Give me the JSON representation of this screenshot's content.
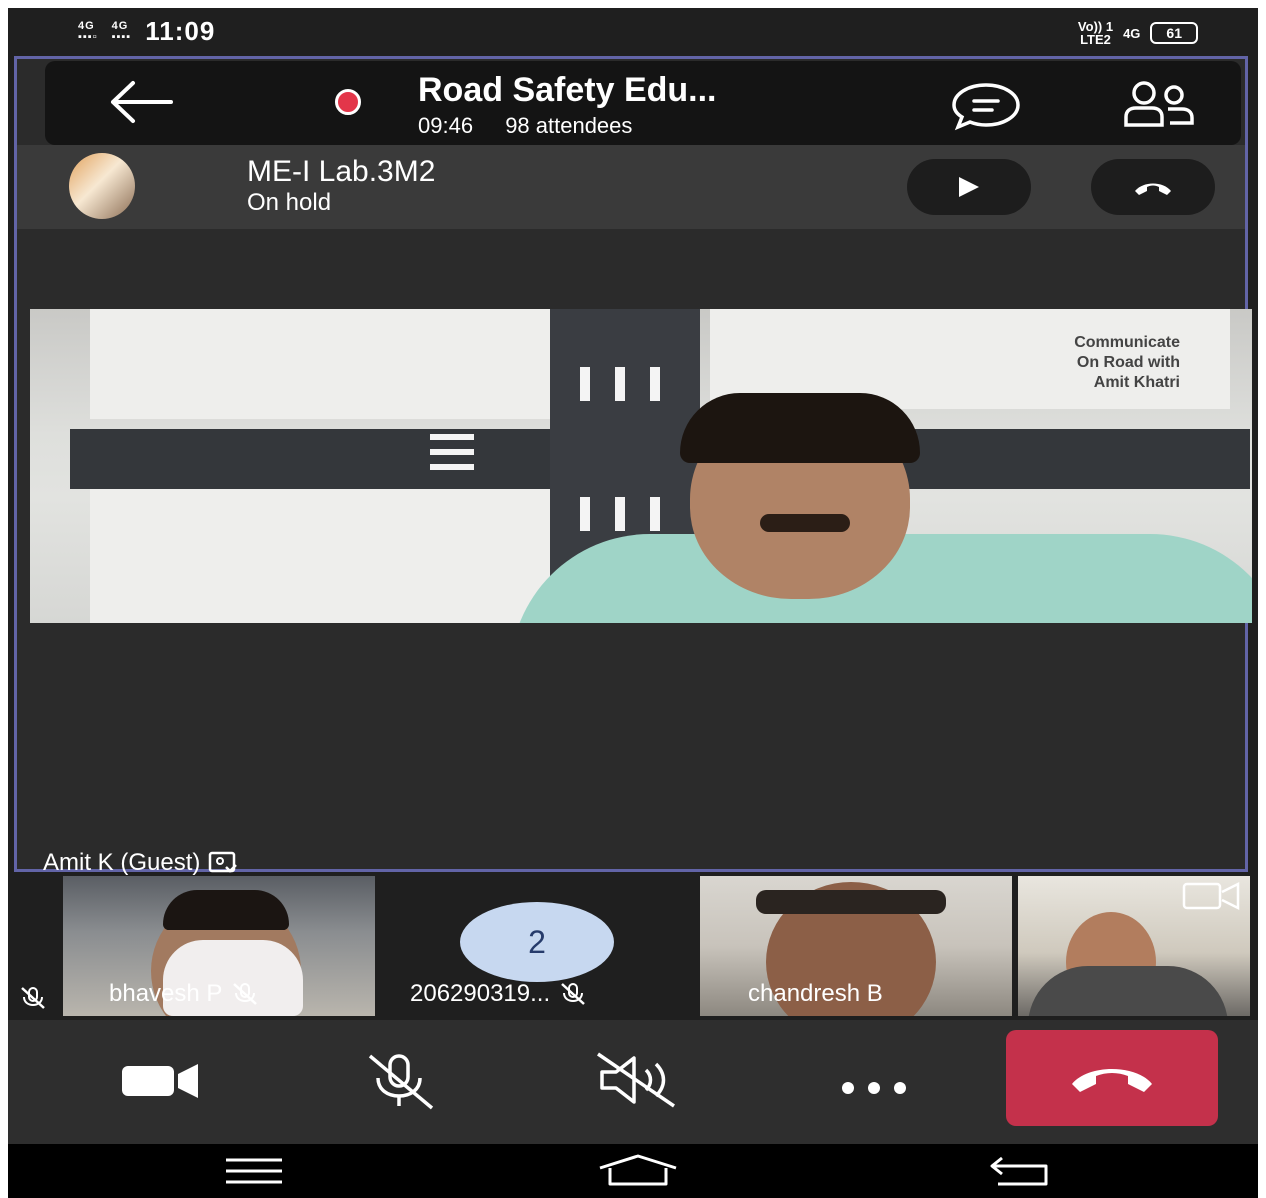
{
  "status_bar": {
    "network_1": "4G",
    "network_2": "4G",
    "time": "11:09",
    "right_text_1": "Vo)) 1",
    "right_text_2": "LTE2",
    "network_3": "4G",
    "battery": "61"
  },
  "meeting": {
    "title": "Road Safety Edu...",
    "duration": "09:46",
    "attendees": "98 attendees"
  },
  "hold_call": {
    "name": "ME-I Lab.3M2",
    "status": "On hold"
  },
  "stage": {
    "poster_text": "Communicate\nOn Road with\nAmit Khatri",
    "speaker_label": "Amit K (Guest)"
  },
  "participants": [
    {
      "name": "bhavesh P"
    },
    {
      "name": "206290319...",
      "avatar_text": "2"
    },
    {
      "name": "chandresh B"
    },
    {
      "name": ""
    }
  ],
  "colors": {
    "accent": "#6264a7",
    "record": "#e3364a",
    "hangup": "#c4314b",
    "background": "#1f1f1f"
  }
}
